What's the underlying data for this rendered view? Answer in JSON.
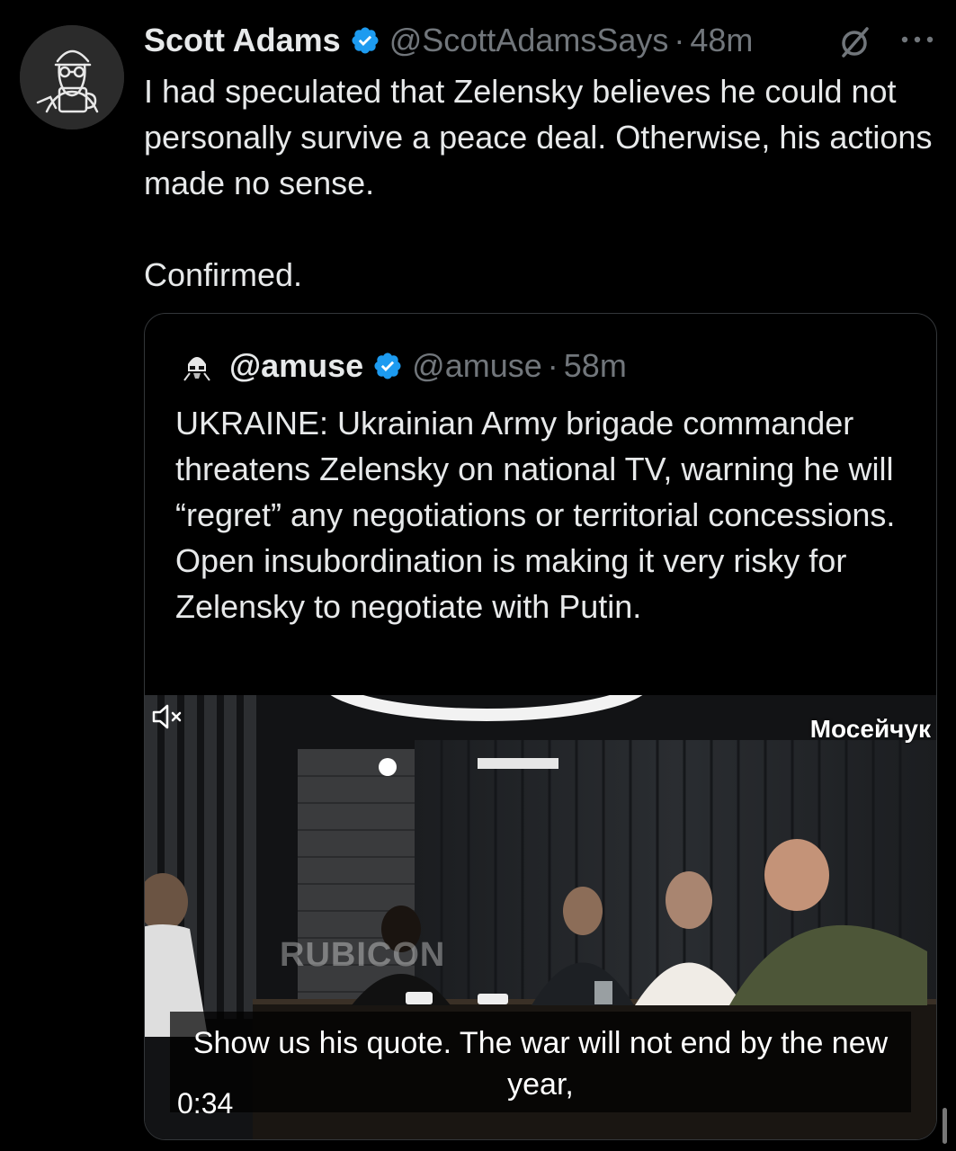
{
  "tweet": {
    "author_name": "Scott Adams",
    "handle": "@ScottAdamsSays",
    "separator": "·",
    "time": "48m",
    "text": "I had speculated that Zelensky believes he could not personally survive a peace deal. Otherwise, his actions made no sense.\n\nConfirmed.",
    "icons": {
      "verified": "verified-badge-icon",
      "grok": "grok-icon",
      "more": "more-icon"
    },
    "colors": {
      "verified": "#1d9bf0",
      "muted_text": "#71767b",
      "text": "#e7e9ea"
    }
  },
  "quoted_tweet": {
    "author_name": "@amuse",
    "handle": "@amuse",
    "separator": "·",
    "time": "58m",
    "text": "UKRAINE: Ukrainian Army brigade commander threatens Zelensky on national TV, warning he will “regret” any negotiations or territorial concessions. Open insubordination is making it very risky for Zelensky to negotiate with Putin.",
    "video": {
      "channel_label": "Мосейчук",
      "watermark": "RUBICON",
      "caption": "Show us his quote. The war will not end by the new year,",
      "duration": "0:34",
      "mute_icon": "volume-muted-icon"
    }
  }
}
